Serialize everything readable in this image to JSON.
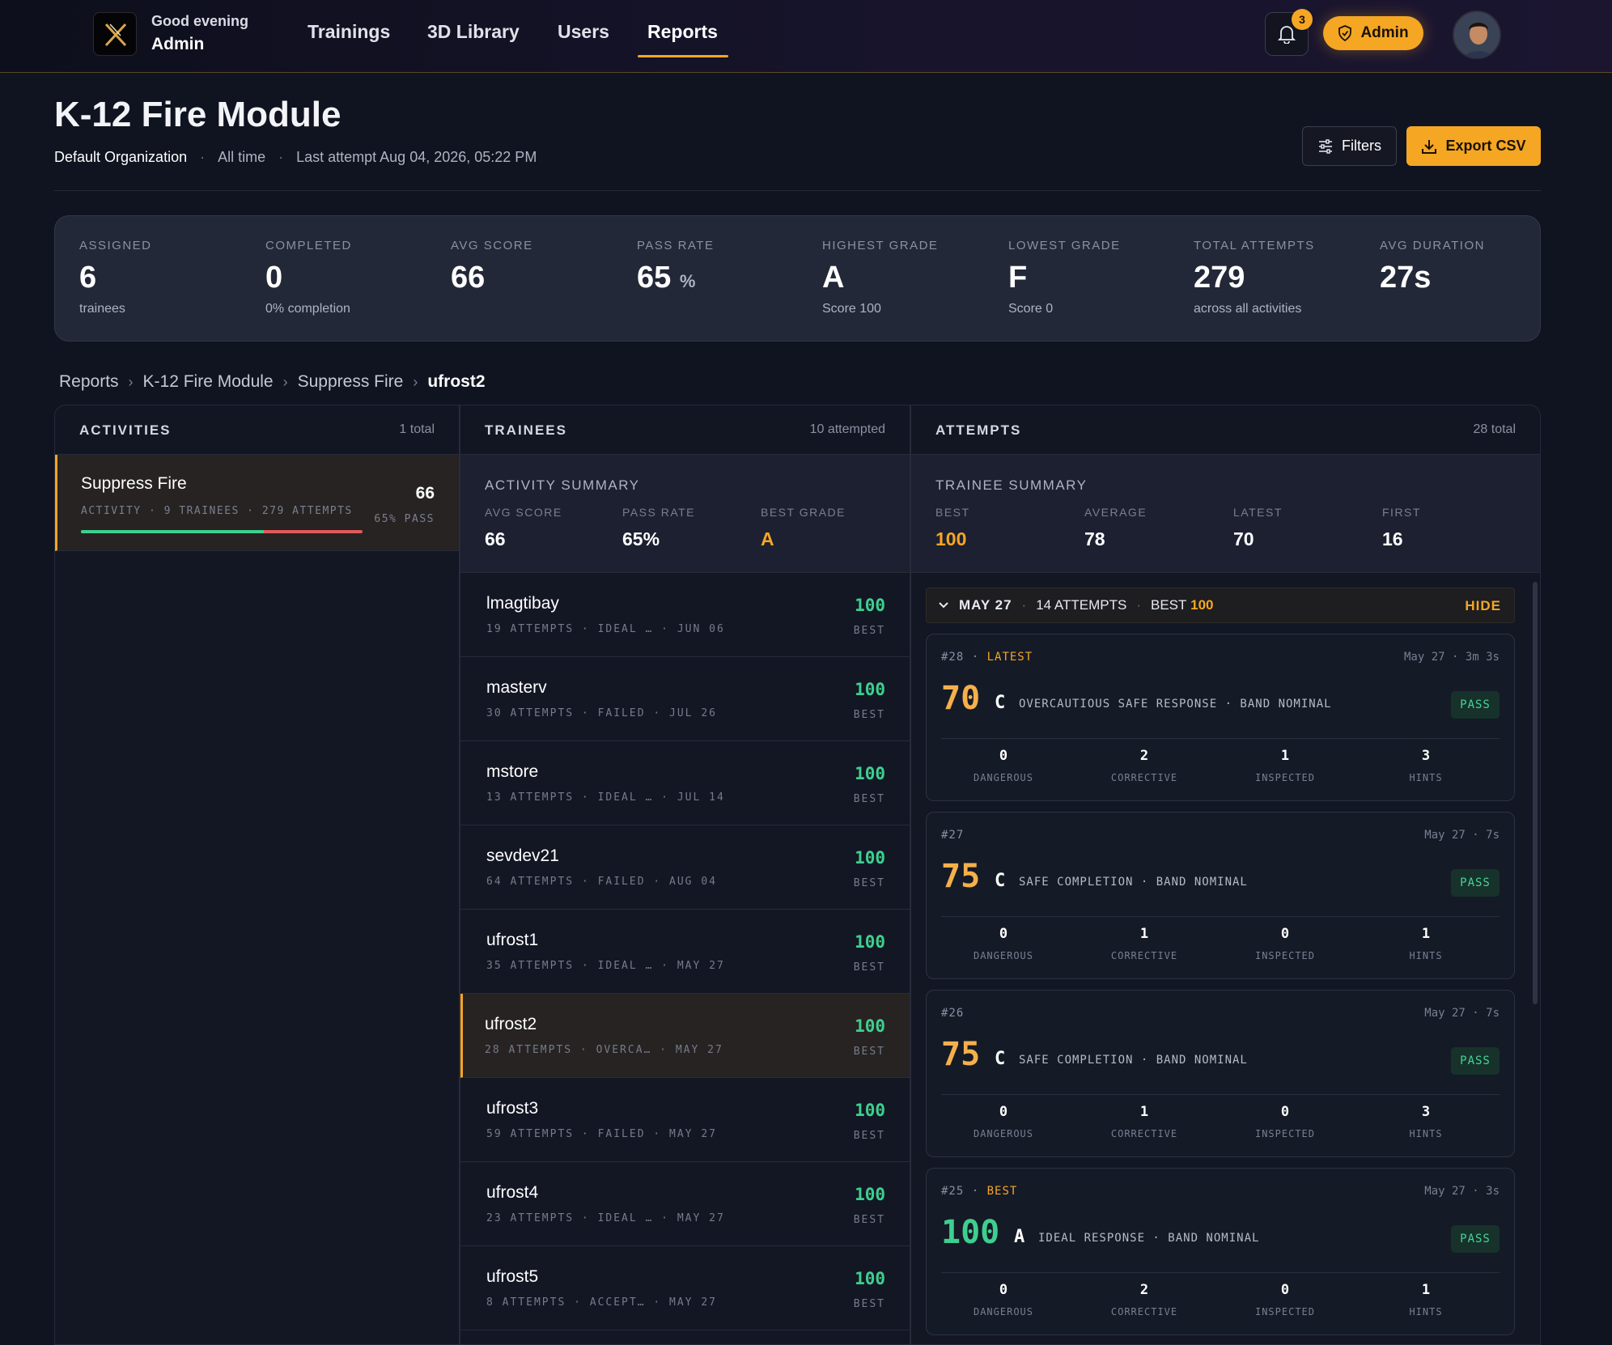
{
  "nav": {
    "greeting": "Good evening",
    "user": "Admin",
    "links": [
      "Trainings",
      "3D Library",
      "Users",
      "Reports"
    ],
    "active": "Reports",
    "notification_count": "3",
    "admin_label": "Admin"
  },
  "header": {
    "title": "K-12 Fire Module",
    "org": "Default Organization",
    "range": "All time",
    "last_attempt": "Last attempt Aug 04, 2026, 05:22 PM",
    "filters_label": "Filters",
    "export_label": "Export CSV"
  },
  "stats": [
    {
      "label": "ASSIGNED",
      "value": "6",
      "unit": "",
      "sub": "trainees"
    },
    {
      "label": "COMPLETED",
      "value": "0",
      "unit": "",
      "sub": "0% completion"
    },
    {
      "label": "AVG SCORE",
      "value": "66",
      "unit": "",
      "sub": ""
    },
    {
      "label": "PASS RATE",
      "value": "65",
      "unit": "%",
      "sub": ""
    },
    {
      "label": "HIGHEST GRADE",
      "value": "A",
      "unit": "",
      "sub": "Score 100"
    },
    {
      "label": "LOWEST GRADE",
      "value": "F",
      "unit": "",
      "sub": "Score 0"
    },
    {
      "label": "TOTAL ATTEMPTS",
      "value": "279",
      "unit": "",
      "sub": "across all activities"
    },
    {
      "label": "AVG DURATION",
      "value": "27s",
      "unit": "",
      "sub": ""
    }
  ],
  "breadcrumb": [
    "Reports",
    "K-12 Fire Module",
    "Suppress Fire",
    "ufrost2"
  ],
  "activities": {
    "title": "ACTIVITIES",
    "count": "1 total",
    "items": [
      {
        "name": "Suppress Fire",
        "meta": "ACTIVITY · 9 TRAINEES · 279 ATTEMPTS",
        "score": "66",
        "pass": "65% PASS",
        "pass_fraction": 0.65
      }
    ]
  },
  "trainees": {
    "title": "TRAINEES",
    "count": "10 attempted",
    "summary_title": "ACTIVITY SUMMARY",
    "summary": [
      {
        "k": "AVG SCORE",
        "v": "66"
      },
      {
        "k": "PASS RATE",
        "v": "65%"
      },
      {
        "k": "BEST GRADE",
        "v": "A"
      }
    ],
    "rows": [
      {
        "name": "lmagtibay",
        "meta": "19 ATTEMPTS · IDEAL … · JUN 06",
        "score": "100",
        "best": "BEST"
      },
      {
        "name": "masterv",
        "meta": "30 ATTEMPTS · FAILED · JUL 26",
        "score": "100",
        "best": "BEST"
      },
      {
        "name": "mstore",
        "meta": "13 ATTEMPTS · IDEAL … · JUL 14",
        "score": "100",
        "best": "BEST"
      },
      {
        "name": "sevdev21",
        "meta": "64 ATTEMPTS · FAILED · AUG 04",
        "score": "100",
        "best": "BEST"
      },
      {
        "name": "ufrost1",
        "meta": "35 ATTEMPTS · IDEAL … · MAY 27",
        "score": "100",
        "best": "BEST"
      },
      {
        "name": "ufrost2",
        "meta": "28 ATTEMPTS · OVERCA… · MAY 27",
        "score": "100",
        "best": "BEST"
      },
      {
        "name": "ufrost3",
        "meta": "59 ATTEMPTS · FAILED · MAY 27",
        "score": "100",
        "best": "BEST"
      },
      {
        "name": "ufrost4",
        "meta": "23 ATTEMPTS · IDEAL … · MAY 27",
        "score": "100",
        "best": "BEST"
      },
      {
        "name": "ufrost5",
        "meta": "8 ATTEMPTS · ACCEPT… · MAY 27",
        "score": "100",
        "best": "BEST"
      }
    ]
  },
  "attempts": {
    "title": "ATTEMPTS",
    "count": "28 total",
    "summary_title": "TRAINEE SUMMARY",
    "summary": [
      {
        "k": "BEST",
        "v": "100"
      },
      {
        "k": "AVERAGE",
        "v": "78"
      },
      {
        "k": "LATEST",
        "v": "70"
      },
      {
        "k": "FIRST",
        "v": "16"
      }
    ],
    "group": {
      "date": "MAY 27",
      "attempts": "14 ATTEMPTS",
      "best_label": "BEST",
      "best": "100",
      "hide": "HIDE"
    },
    "cards": [
      {
        "num": "#28",
        "tag": "LATEST",
        "date": "May 27 · 3m 3s",
        "score": "70",
        "grade": "C",
        "desc": "OVERCAUTIOUS SAFE RESPONSE · BAND NOMINAL",
        "status": "PASS",
        "metrics": [
          {
            "n": "0",
            "l": "DANGEROUS"
          },
          {
            "n": "2",
            "l": "CORRECTIVE"
          },
          {
            "n": "1",
            "l": "INSPECTED"
          },
          {
            "n": "3",
            "l": "HINTS"
          }
        ]
      },
      {
        "num": "#27",
        "tag": "",
        "date": "May 27 · 7s",
        "score": "75",
        "grade": "C",
        "desc": "SAFE COMPLETION · BAND NOMINAL",
        "status": "PASS",
        "metrics": [
          {
            "n": "0",
            "l": "DANGEROUS"
          },
          {
            "n": "1",
            "l": "CORRECTIVE"
          },
          {
            "n": "0",
            "l": "INSPECTED"
          },
          {
            "n": "1",
            "l": "HINTS"
          }
        ]
      },
      {
        "num": "#26",
        "tag": "",
        "date": "May 27 · 7s",
        "score": "75",
        "grade": "C",
        "desc": "SAFE COMPLETION · BAND NOMINAL",
        "status": "PASS",
        "metrics": [
          {
            "n": "0",
            "l": "DANGEROUS"
          },
          {
            "n": "1",
            "l": "CORRECTIVE"
          },
          {
            "n": "0",
            "l": "INSPECTED"
          },
          {
            "n": "3",
            "l": "HINTS"
          }
        ]
      },
      {
        "num": "#25",
        "tag": "BEST",
        "date": "May 27 · 3s",
        "score": "100",
        "grade": "A",
        "desc": "IDEAL RESPONSE · BAND NOMINAL",
        "status": "PASS",
        "metrics": [
          {
            "n": "0",
            "l": "DANGEROUS"
          },
          {
            "n": "2",
            "l": "CORRECTIVE"
          },
          {
            "n": "0",
            "l": "INSPECTED"
          },
          {
            "n": "1",
            "l": "HINTS"
          }
        ]
      }
    ]
  }
}
